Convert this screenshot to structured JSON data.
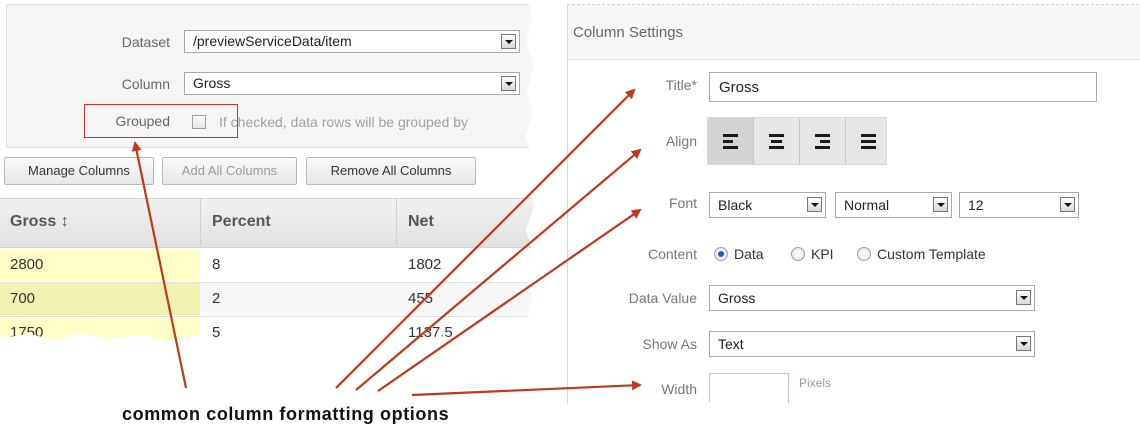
{
  "left": {
    "dataset_label": "Dataset",
    "dataset_value": "/previewServiceData/item",
    "column_label": "Column",
    "column_value": "Gross",
    "grouped_label": "Grouped",
    "grouped_hint": "If checked, data rows will be grouped by",
    "buttons": {
      "manage": "Manage Columns",
      "add_all": "Add All Columns",
      "remove_all": "Remove All Columns"
    },
    "table": {
      "headers": [
        "Gross ↕",
        "Percent",
        "Net"
      ],
      "rows": [
        [
          "2800",
          "8",
          "1802"
        ],
        [
          "700",
          "2",
          "455"
        ],
        [
          "1750",
          "5",
          "1137.5"
        ]
      ]
    }
  },
  "right": {
    "panel_title": "Column Settings",
    "title_label": "Title*",
    "title_value": "Gross",
    "align_label": "Align",
    "font_label": "Font",
    "font_color": "Black",
    "font_weight": "Normal",
    "font_size": "12",
    "content_label": "Content",
    "content_options": [
      "Data",
      "KPI",
      "Custom Template"
    ],
    "content_selected": "Data",
    "data_value_label": "Data Value",
    "data_value": "Gross",
    "show_as_label": "Show As",
    "show_as_value": "Text",
    "width_label": "Width",
    "width_value": "",
    "width_unit": "Pixels"
  },
  "caption": "common column formatting options",
  "colors": {
    "arrow": "#c0391b",
    "highlight_cell": "#ffffc8",
    "highlight_cell_selected": "#f2f2b0",
    "grouped_frame": "#d03030"
  }
}
